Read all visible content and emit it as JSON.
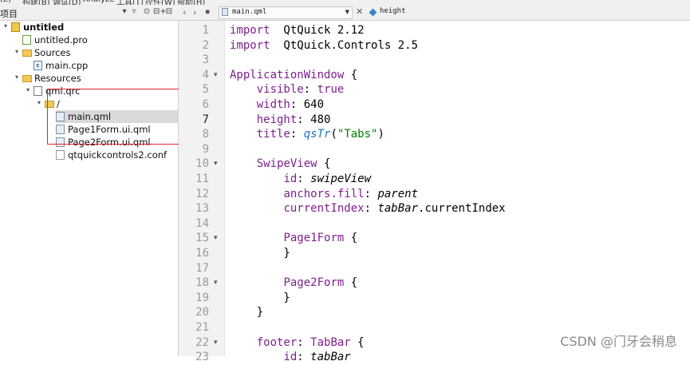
{
  "menubar": {
    "items": [
      "(E)",
      "构建(B)",
      "调试(D)",
      "Analyze",
      "工具(T)",
      "控件(W)",
      "帮助(H)"
    ]
  },
  "project_panel": {
    "title": "项目",
    "header_buttons": [
      "▾",
      "▿",
      "⊙",
      "⊟+",
      "⊟",
      "□"
    ]
  },
  "editor_toolbar": {
    "file_name": "main.qml",
    "symbol_name": "height"
  },
  "tree": [
    {
      "label": "untitled",
      "icon": "project-icon",
      "bold": true,
      "arrow": "▾",
      "level": 0
    },
    {
      "label": "untitled.pro",
      "icon": "pro-file-icon",
      "bold": false,
      "arrow": "",
      "level": 1
    },
    {
      "label": "Sources",
      "icon": "folder-icon",
      "bold": false,
      "arrow": "▾",
      "level": 1
    },
    {
      "label": "main.cpp",
      "icon": "cpp-file-icon",
      "bold": false,
      "arrow": "",
      "level": 2
    },
    {
      "label": "Resources",
      "icon": "folder-icon",
      "bold": false,
      "arrow": "▾",
      "level": 1
    },
    {
      "label": "qml.qrc",
      "icon": "qrc-file-icon",
      "bold": false,
      "arrow": "▾",
      "level": 2
    },
    {
      "label": "/",
      "icon": "folder-icon",
      "bold": false,
      "arrow": "▾",
      "level": 3
    },
    {
      "label": "main.qml",
      "icon": "qml-file-icon",
      "bold": false,
      "arrow": "",
      "level": 4,
      "selected": true
    },
    {
      "label": "Page1Form.ui.qml",
      "icon": "qml-file-icon",
      "bold": false,
      "arrow": "",
      "level": 4
    },
    {
      "label": "Page2Form.ui.qml",
      "icon": "qml-file-icon",
      "bold": false,
      "arrow": "",
      "level": 4
    },
    {
      "label": "qtquickcontrols2.conf",
      "icon": "conf-file-icon",
      "bold": false,
      "arrow": "",
      "level": 4
    }
  ],
  "current_line": 7,
  "code_lines": [
    {
      "n": "1",
      "fold": "",
      "t": [
        [
          "kw",
          "import"
        ],
        [
          "",
          "  QtQuick 2.12"
        ]
      ]
    },
    {
      "n": "2",
      "fold": "",
      "t": [
        [
          "kw",
          "import"
        ],
        [
          "",
          "  QtQuick.Controls 2.5"
        ]
      ]
    },
    {
      "n": "3",
      "fold": "",
      "t": []
    },
    {
      "n": "4",
      "fold": "▾",
      "t": [
        [
          "ty",
          "ApplicationWindow"
        ],
        [
          "",
          " {"
        ]
      ]
    },
    {
      "n": "5",
      "fold": "",
      "t": [
        [
          "",
          "    "
        ],
        [
          "pr",
          "visible"
        ],
        [
          "",
          ": "
        ],
        [
          "kw",
          "true"
        ]
      ]
    },
    {
      "n": "6",
      "fold": "",
      "t": [
        [
          "",
          "    "
        ],
        [
          "pr",
          "width"
        ],
        [
          "",
          ": 640"
        ]
      ]
    },
    {
      "n": "7",
      "fold": "",
      "t": [
        [
          "",
          "    "
        ],
        [
          "pr",
          "height"
        ],
        [
          "",
          ": 480"
        ]
      ]
    },
    {
      "n": "8",
      "fold": "",
      "t": [
        [
          "",
          "    "
        ],
        [
          "pr",
          "title"
        ],
        [
          "",
          ": "
        ],
        [
          "fn",
          "qsTr"
        ],
        [
          "",
          "("
        ],
        [
          "str",
          "\"Tabs\""
        ],
        [
          "",
          ")"
        ]
      ]
    },
    {
      "n": "9",
      "fold": "",
      "t": []
    },
    {
      "n": "10",
      "fold": "▾",
      "t": [
        [
          "",
          "    "
        ],
        [
          "ty",
          "SwipeView"
        ],
        [
          "",
          " {"
        ]
      ]
    },
    {
      "n": "11",
      "fold": "",
      "t": [
        [
          "",
          "        "
        ],
        [
          "pr",
          "id"
        ],
        [
          "",
          ": "
        ],
        [
          "it",
          "swipeView"
        ]
      ]
    },
    {
      "n": "12",
      "fold": "",
      "t": [
        [
          "",
          "        "
        ],
        [
          "pr",
          "anchors.fill"
        ],
        [
          "",
          ": "
        ],
        [
          "it",
          "parent"
        ]
      ]
    },
    {
      "n": "13",
      "fold": "",
      "t": [
        [
          "",
          "        "
        ],
        [
          "pr",
          "currentIndex"
        ],
        [
          "",
          ": "
        ],
        [
          "it",
          "tabBar"
        ],
        [
          "",
          ".currentIndex"
        ]
      ]
    },
    {
      "n": "14",
      "fold": "",
      "t": []
    },
    {
      "n": "15",
      "fold": "▾",
      "t": [
        [
          "",
          "        "
        ],
        [
          "ty",
          "Page1Form"
        ],
        [
          "",
          " {"
        ]
      ]
    },
    {
      "n": "16",
      "fold": "",
      "t": [
        [
          "",
          "        }"
        ]
      ]
    },
    {
      "n": "17",
      "fold": "",
      "t": []
    },
    {
      "n": "18",
      "fold": "▾",
      "t": [
        [
          "",
          "        "
        ],
        [
          "ty",
          "Page2Form"
        ],
        [
          "",
          " {"
        ]
      ]
    },
    {
      "n": "19",
      "fold": "",
      "t": [
        [
          "",
          "        }"
        ]
      ]
    },
    {
      "n": "20",
      "fold": "",
      "t": [
        [
          "",
          "    }"
        ]
      ]
    },
    {
      "n": "21",
      "fold": "",
      "t": []
    },
    {
      "n": "22",
      "fold": "▾",
      "t": [
        [
          "",
          "    "
        ],
        [
          "pr",
          "footer"
        ],
        [
          "",
          ": "
        ],
        [
          "ty",
          "TabBar"
        ],
        [
          "",
          " {"
        ]
      ]
    },
    {
      "n": "23",
      "fold": "",
      "t": [
        [
          "",
          "        "
        ],
        [
          "pr",
          "id"
        ],
        [
          "",
          ": "
        ],
        [
          "it",
          "tabBar"
        ]
      ]
    }
  ],
  "watermark": "CSDN @门牙会稍息"
}
